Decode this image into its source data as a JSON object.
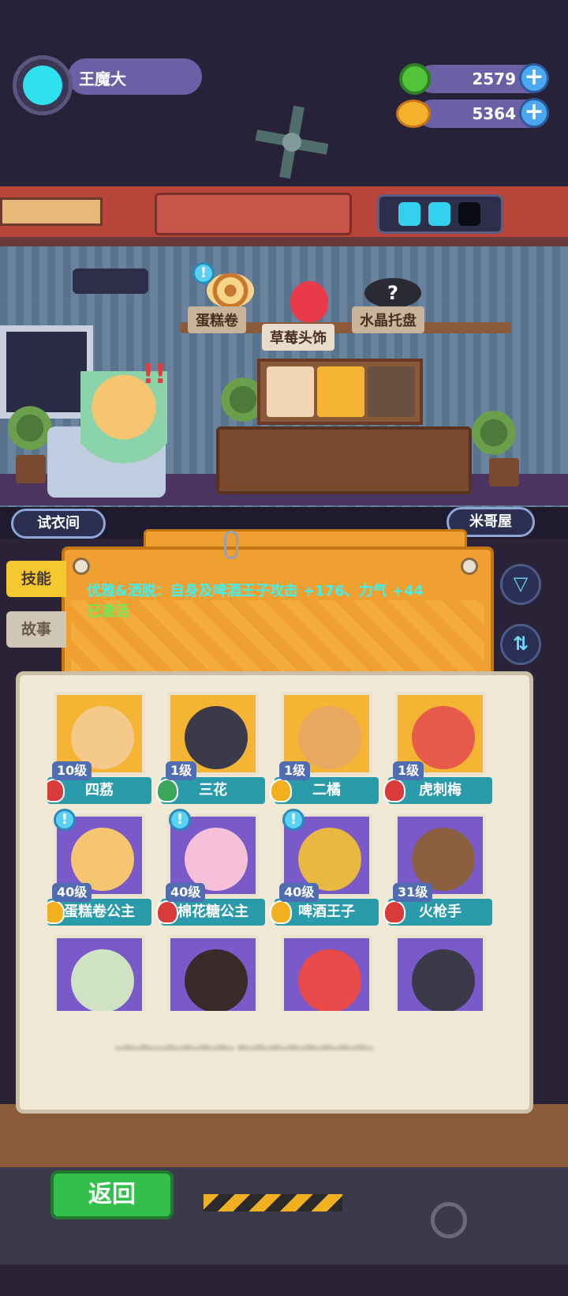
{
  "player": {
    "name": "王魔大"
  },
  "currencies": [
    {
      "icon": "green-gem-icon",
      "value": "2579"
    },
    {
      "icon": "planet-coin-icon",
      "value": "5364"
    }
  ],
  "room": {
    "slots": [
      {
        "label": "蛋糕卷",
        "icon": "cake-roll-icon"
      },
      {
        "label": "草莓头饰",
        "icon": "strawberry-icon"
      },
      {
        "label": "水晶托盘",
        "icon": "hat-icon"
      }
    ],
    "hat_mark": "?",
    "bubble_mark": "!",
    "exclaim": "!!",
    "nav_left": "试衣间",
    "nav_right": "米哥屋"
  },
  "tabs": {
    "skill": "技能",
    "story": "故事"
  },
  "skill": {
    "text": "优雅&洒脱：自身及啤酒王子攻击 +176、力气 +44",
    "status": "已激活"
  },
  "buttons": {
    "filter": "▽",
    "sort": "⇅",
    "back": "返回",
    "plus": "+"
  },
  "characters": [
    {
      "level": "10级",
      "name": "四荔",
      "rank": "red",
      "bg": "yellow"
    },
    {
      "level": "1级",
      "name": "三花",
      "rank": "green",
      "bg": "yellow"
    },
    {
      "level": "1级",
      "name": "二橘",
      "rank": "gold",
      "bg": "yellow"
    },
    {
      "level": "1级",
      "name": "虎刺梅",
      "rank": "red",
      "bg": "yellow"
    },
    {
      "level": "40级",
      "name": "蛋糕卷公主",
      "rank": "gold",
      "bg": "purple"
    },
    {
      "level": "40级",
      "name": "棉花糖公主",
      "rank": "red",
      "bg": "purple"
    },
    {
      "level": "40级",
      "name": "啤酒王子",
      "rank": "gold",
      "bg": "purple"
    },
    {
      "level": "31级",
      "name": "火枪手",
      "rank": "red",
      "bg": "purple"
    },
    {
      "level": "",
      "name": "",
      "rank": "",
      "bg": "purple"
    },
    {
      "level": "",
      "name": "",
      "rank": "",
      "bg": "purple"
    },
    {
      "level": "",
      "name": "",
      "rank": "",
      "bg": "purple"
    },
    {
      "level": "",
      "name": "",
      "rank": "",
      "bg": "purple"
    }
  ],
  "colors": {
    "accent": "#2a9bab",
    "card": "#f0a030",
    "skill_text": "#3ef0f0",
    "active": "#6ee85a"
  }
}
